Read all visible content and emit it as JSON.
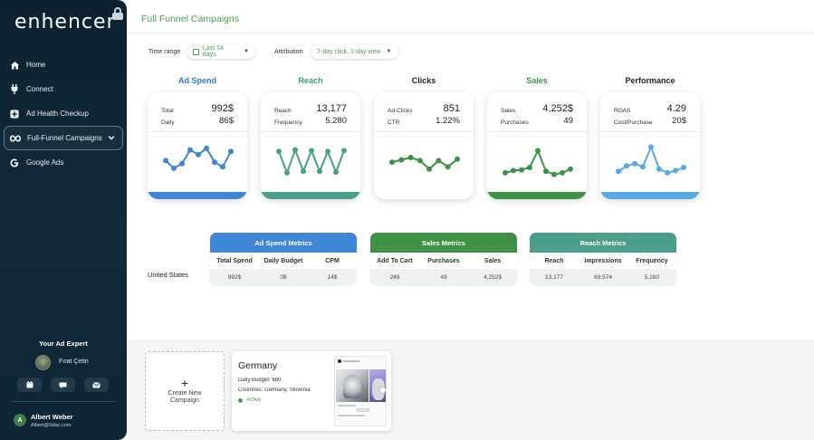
{
  "app": {
    "logo_text": "enhencer"
  },
  "sidebar": {
    "items": [
      {
        "label": "Home",
        "icon": "home-icon"
      },
      {
        "label": "Connect",
        "icon": "plug-icon"
      },
      {
        "label": "Ad Health Checkup",
        "icon": "plus-square-icon"
      },
      {
        "label": "Full-Funnel Campaigns",
        "icon": "infinity-icon",
        "active": true
      },
      {
        "label": "Google Ads",
        "icon": "google-icon"
      }
    ],
    "expert_title": "Your Ad Expert",
    "expert_name": "Fırat Çetin",
    "expert_buttons": [
      "calendar-icon",
      "message-icon",
      "mail-icon"
    ],
    "user": {
      "initial": "A",
      "name": "Albert Weber",
      "email": "Albert@Sdac.com"
    }
  },
  "header": {
    "title": "Full Funnel Campaigns"
  },
  "filters": {
    "time_range_label": "Time range",
    "time_range_value": "Last 14 days",
    "attribution_label": "Attribution",
    "attribution_value": "7-day click, 1-day view"
  },
  "colors": {
    "blue": "#3f86d6",
    "teal": "#4a9e8a",
    "green": "#3f9145",
    "light_blue": "#58a9e6",
    "accent_green": "#4a9a55"
  },
  "metric_cards": [
    {
      "title": "Ad Spend",
      "title_color": "#2f7dc8",
      "line_color": "#3f86d6",
      "bar_color": "#3f86d6",
      "rows": [
        {
          "label": "Total",
          "value": "992$"
        },
        {
          "label": "Daily",
          "value": "86$"
        }
      ],
      "trend": [
        4.2,
        3.2,
        3.8,
        5.6,
        5.0,
        5.8,
        4.0,
        3.4,
        5.4
      ]
    },
    {
      "title": "Reach",
      "title_color": "#3f9580",
      "line_color": "#4a9e8a",
      "bar_color": "#4a9e8a",
      "rows": [
        {
          "label": "Reach",
          "value": "13,177"
        },
        {
          "label": "Frequency",
          "value": "5.280"
        }
      ],
      "trend": [
        5.4,
        2.6,
        5.6,
        2.8,
        5.5,
        2.8,
        5.4,
        2.7,
        5.5
      ]
    },
    {
      "title": "Clicks",
      "title_color": "#222222",
      "line_color": "#3f9145",
      "bar_color": null,
      "rows": [
        {
          "label": "Ad-Clicks",
          "value": "851"
        },
        {
          "label": "CTR",
          "value": "1.22%"
        }
      ],
      "trend": [
        4.0,
        4.3,
        4.6,
        4.2,
        3.1,
        4.2,
        3.4,
        4.4
      ]
    },
    {
      "title": "Sales",
      "title_color": "#3f9145",
      "line_color": "#3f9145",
      "bar_color": "#3f9145",
      "rows": [
        {
          "label": "Sales",
          "value": "4,252$"
        },
        {
          "label": "Purchases",
          "value": "49"
        }
      ],
      "trend": [
        2.6,
        2.9,
        3.0,
        3.3,
        5.5,
        2.8,
        2.4,
        2.6,
        3.1
      ]
    },
    {
      "title": "Performance",
      "title_color": "#222222",
      "line_color": "#58a9e6",
      "bar_color": "#58a9e6",
      "rows": [
        {
          "label": "ROAS",
          "value": "4.29"
        },
        {
          "label": "Cost/Purchase",
          "value": "20$"
        }
      ],
      "trend": [
        2.8,
        3.5,
        3.8,
        3.4,
        6.0,
        3.1,
        2.6,
        2.9,
        3.3
      ]
    }
  ],
  "metrics_tables": {
    "country": "United States",
    "tables": [
      {
        "title": "Ad Spend Metrics",
        "color": "#3f86d6",
        "columns": [
          "Total Spend",
          "Daily Budget",
          "CPM"
        ],
        "values": [
          "992$",
          "0$",
          "14$"
        ]
      },
      {
        "title": "Sales Metrics",
        "color": "#3f9145",
        "columns": [
          "Add To Cart",
          "Purchases",
          "Sales"
        ],
        "values": [
          "249",
          "49",
          "4,252$"
        ]
      },
      {
        "title": "Reach Metrics",
        "color": "#4a9e8a",
        "columns": [
          "Reach",
          "Impressions",
          "Frequency"
        ],
        "values": [
          "13,177",
          "69,574",
          "5.280"
        ]
      }
    ]
  },
  "campaigns": {
    "create_label": "Create New Campaign",
    "items": [
      {
        "name": "Germany",
        "budget_label": "Daily Budget:",
        "budget_value": "$80",
        "countries_label": "Countries:",
        "countries_value": "Germany, Slovenia",
        "status": "Active"
      }
    ]
  }
}
